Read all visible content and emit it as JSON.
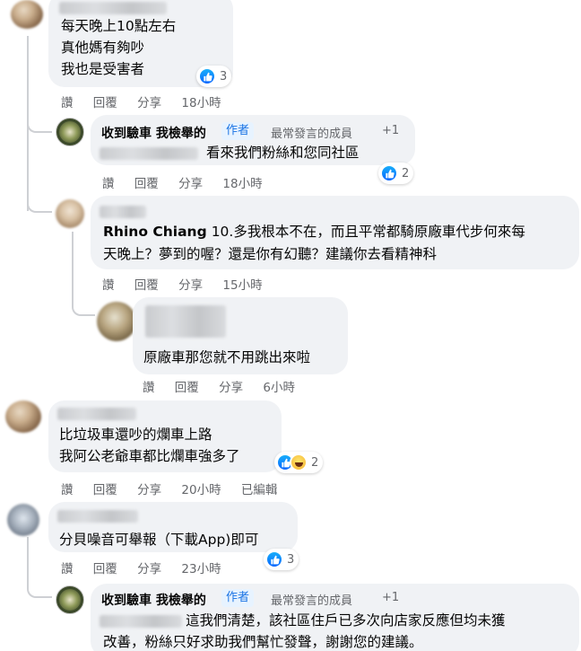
{
  "comments": [
    {
      "lines": [
        "每天晚上10點左右",
        "真他媽有夠吵",
        "我也是受害者"
      ],
      "reactions": {
        "count": "3"
      },
      "actions": {
        "like": "讚",
        "reply": "回覆",
        "share": "分享",
        "time": "18小時"
      }
    },
    {
      "author": "收到驗車 我檢舉的",
      "badges": {
        "author": "作者",
        "top": "最常發言的成員",
        "plus": "+1"
      },
      "text": "看來我們粉絲和您同社區",
      "reactions": {
        "count": "2"
      },
      "actions": {
        "like": "讚",
        "reply": "回覆",
        "share": "分享",
        "time": "18小時"
      }
    },
    {
      "mention": "Rhino Chiang",
      "lines": [
        "10.多我根本不在，而且平常都騎原廠車代步何來每",
        "天晚上？夢到的喔？還是你有幻聽？建議你去看精神科"
      ],
      "actions": {
        "like": "讚",
        "reply": "回覆",
        "share": "分享",
        "time": "15小時"
      }
    },
    {
      "text": "原廠車那您就不用跳出來啦",
      "actions": {
        "like": "讚",
        "reply": "回覆",
        "share": "分享",
        "time": "6小時"
      }
    },
    {
      "lines": [
        "比垃圾車還吵的爛車上路",
        "我阿公老爺車都比爛車強多了"
      ],
      "reactions": {
        "count": "2"
      },
      "actions": {
        "like": "讚",
        "reply": "回覆",
        "share": "分享",
        "time": "20小時",
        "edited": "已編輯"
      }
    },
    {
      "text": "分貝噪音可舉報（下載App)即可",
      "reactions": {
        "count": "3"
      },
      "actions": {
        "like": "讚",
        "reply": "回覆",
        "share": "分享",
        "time": "23小時"
      }
    },
    {
      "author": "收到驗車 我檢舉的",
      "badges": {
        "author": "作者",
        "top": "最常發言的成員",
        "plus": "+1"
      },
      "lines": [
        "這我們清楚，該社區住戶已多次向店家反應但均未獲",
        "改善，粉絲只好求助我們幫忙發聲，謝謝您的建議。"
      ]
    }
  ],
  "page_avatar_text": "收到驗車 我檢舉的"
}
